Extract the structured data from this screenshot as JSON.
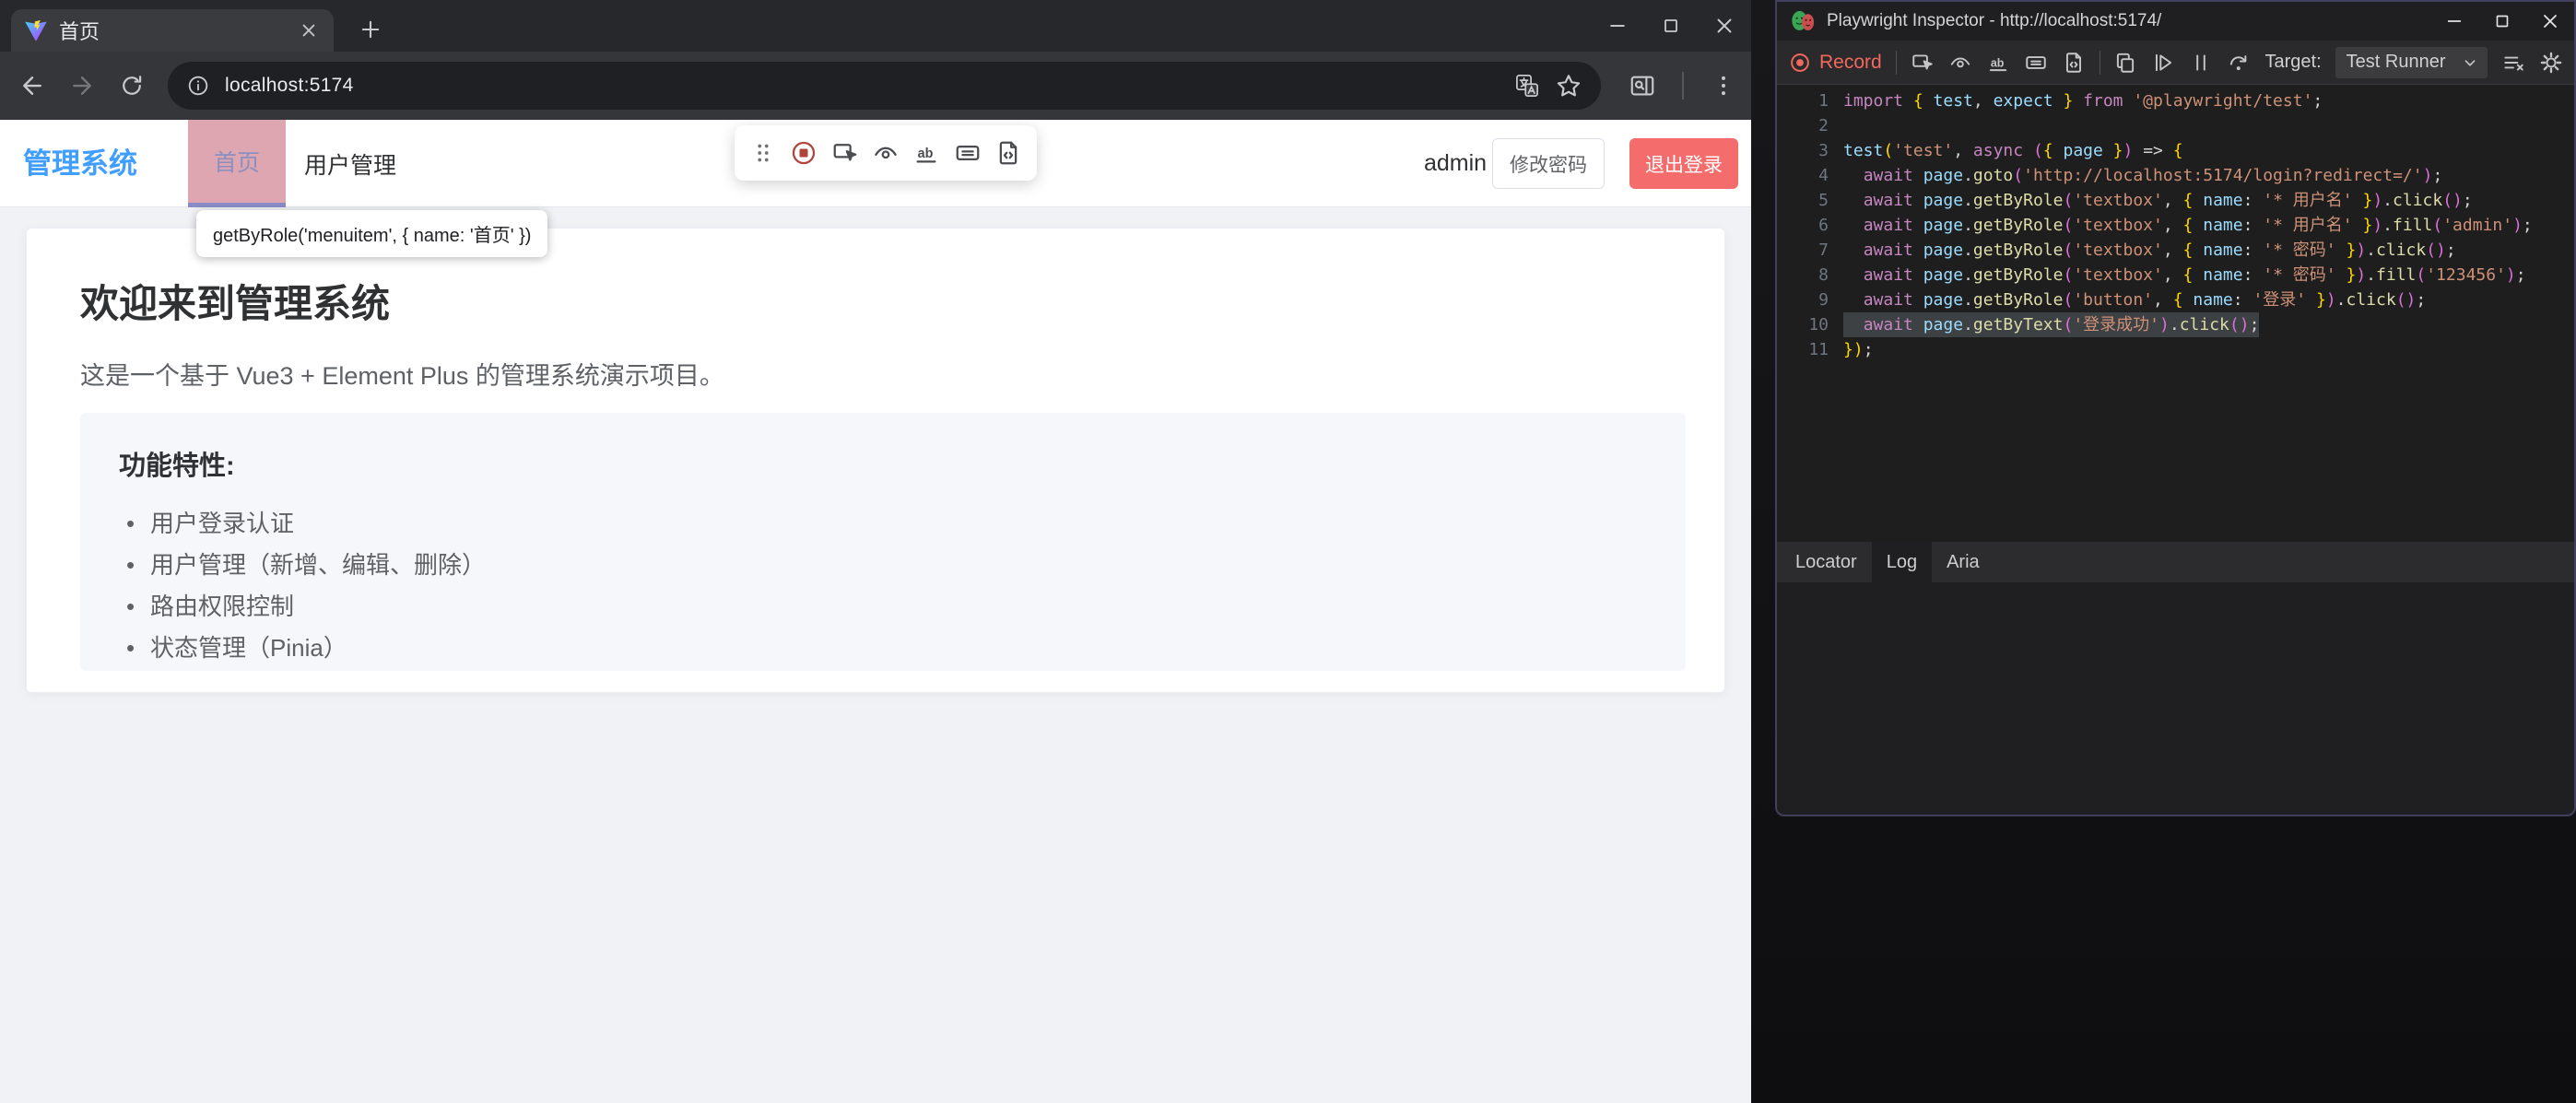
{
  "colors": {
    "brand_blue": "#409eff",
    "danger_red": "#f56c6c",
    "record_red": "#f2685c",
    "pick_highlight_pink": "#dda6b0"
  },
  "browser": {
    "tab_title": "首页",
    "url": "localhost:5174",
    "toolbar_icons": [
      "back",
      "forward",
      "reload"
    ],
    "url_icons": [
      "info",
      "translate",
      "star"
    ],
    "right_icons": [
      "side-panel-search",
      "kebab-menu"
    ]
  },
  "page": {
    "logo": "管理系统",
    "menu": [
      {
        "label": "首页",
        "active": true
      },
      {
        "label": "用户管理",
        "active": false
      }
    ],
    "user": "admin",
    "buttons": {
      "change_password": "修改密码",
      "logout": "退出登录"
    },
    "tooltip": "getByRole('menuitem', { name: '首页' })",
    "float_toolbar": [
      "drag-handle",
      "record",
      "pick-locator",
      "assert-visibility",
      "assert-text",
      "assert-value",
      "assert-snapshot"
    ],
    "heading": "欢迎来到管理系统",
    "description": "这是一个基于 Vue3 + Element Plus 的管理系统演示项目。",
    "features_title": "功能特性:",
    "features": [
      "用户登录认证",
      "用户管理（新增、编辑、删除）",
      "路由权限控制",
      "状态管理（Pinia）"
    ]
  },
  "inspector": {
    "title": "Playwright Inspector - http://localhost:5174/",
    "record_label": "Record",
    "toolbar_group1": [
      "pick-locator",
      "assert-visibility",
      "assert-text",
      "assert-value",
      "assert-snapshot"
    ],
    "toolbar_group2": [
      "copy",
      "resume",
      "pause",
      "step-over"
    ],
    "target_label": "Target:",
    "target_value": "Test Runner",
    "right_icons": [
      "clear-log",
      "gear"
    ],
    "tabs": [
      {
        "label": "Locator",
        "active": false
      },
      {
        "label": "Log",
        "active": true
      },
      {
        "label": "Aria",
        "active": false
      }
    ],
    "code": {
      "highlighted_line": 10,
      "lines": [
        {
          "n": 1,
          "tokens": [
            [
              "kw",
              "import "
            ],
            [
              "b1",
              "{ "
            ],
            [
              "var",
              "test"
            ],
            [
              "pun",
              ", "
            ],
            [
              "var",
              "expect"
            ],
            [
              "b1",
              " }"
            ],
            [
              "kw",
              " from "
            ],
            [
              "str",
              "'@playwright/test'"
            ],
            [
              "pun",
              ";"
            ]
          ]
        },
        {
          "n": 2,
          "tokens": []
        },
        {
          "n": 3,
          "tokens": [
            [
              "var",
              "test"
            ],
            [
              "b1",
              "("
            ],
            [
              "str",
              "'test'"
            ],
            [
              "pun",
              ", "
            ],
            [
              "kw",
              "async "
            ],
            [
              "b2",
              "("
            ],
            [
              "b1",
              "{ "
            ],
            [
              "var",
              "page"
            ],
            [
              "b1",
              " }"
            ],
            [
              "b2",
              ")"
            ],
            [
              "pun",
              " => "
            ],
            [
              "b1",
              "{"
            ]
          ]
        },
        {
          "n": 4,
          "tokens": [
            [
              "pun",
              "  "
            ],
            [
              "kw",
              "await "
            ],
            [
              "var",
              "page"
            ],
            [
              "pun",
              "."
            ],
            [
              "fn",
              "goto"
            ],
            [
              "b2",
              "("
            ],
            [
              "str",
              "'http://localhost:5174/login?redirect=/'"
            ],
            [
              "b2",
              ")"
            ],
            [
              "pun",
              ";"
            ]
          ]
        },
        {
          "n": 5,
          "tokens": [
            [
              "pun",
              "  "
            ],
            [
              "kw",
              "await "
            ],
            [
              "var",
              "page"
            ],
            [
              "pun",
              "."
            ],
            [
              "fn",
              "getByRole"
            ],
            [
              "b2",
              "("
            ],
            [
              "str",
              "'textbox'"
            ],
            [
              "pun",
              ", "
            ],
            [
              "b1",
              "{ "
            ],
            [
              "var",
              "name"
            ],
            [
              "pun",
              ": "
            ],
            [
              "str",
              "'* 用户名'"
            ],
            [
              "b1",
              " }"
            ],
            [
              "b2",
              ")"
            ],
            [
              "pun",
              "."
            ],
            [
              "fn",
              "click"
            ],
            [
              "b2",
              "()"
            ],
            [
              "pun",
              ";"
            ]
          ]
        },
        {
          "n": 6,
          "tokens": [
            [
              "pun",
              "  "
            ],
            [
              "kw",
              "await "
            ],
            [
              "var",
              "page"
            ],
            [
              "pun",
              "."
            ],
            [
              "fn",
              "getByRole"
            ],
            [
              "b2",
              "("
            ],
            [
              "str",
              "'textbox'"
            ],
            [
              "pun",
              ", "
            ],
            [
              "b1",
              "{ "
            ],
            [
              "var",
              "name"
            ],
            [
              "pun",
              ": "
            ],
            [
              "str",
              "'* 用户名'"
            ],
            [
              "b1",
              " }"
            ],
            [
              "b2",
              ")"
            ],
            [
              "pun",
              "."
            ],
            [
              "fn",
              "fill"
            ],
            [
              "b2",
              "("
            ],
            [
              "str",
              "'admin'"
            ],
            [
              "b2",
              ")"
            ],
            [
              "pun",
              ";"
            ]
          ]
        },
        {
          "n": 7,
          "tokens": [
            [
              "pun",
              "  "
            ],
            [
              "kw",
              "await "
            ],
            [
              "var",
              "page"
            ],
            [
              "pun",
              "."
            ],
            [
              "fn",
              "getByRole"
            ],
            [
              "b2",
              "("
            ],
            [
              "str",
              "'textbox'"
            ],
            [
              "pun",
              ", "
            ],
            [
              "b1",
              "{ "
            ],
            [
              "var",
              "name"
            ],
            [
              "pun",
              ": "
            ],
            [
              "str",
              "'* 密码'"
            ],
            [
              "b1",
              " }"
            ],
            [
              "b2",
              ")"
            ],
            [
              "pun",
              "."
            ],
            [
              "fn",
              "click"
            ],
            [
              "b2",
              "()"
            ],
            [
              "pun",
              ";"
            ]
          ]
        },
        {
          "n": 8,
          "tokens": [
            [
              "pun",
              "  "
            ],
            [
              "kw",
              "await "
            ],
            [
              "var",
              "page"
            ],
            [
              "pun",
              "."
            ],
            [
              "fn",
              "getByRole"
            ],
            [
              "b2",
              "("
            ],
            [
              "str",
              "'textbox'"
            ],
            [
              "pun",
              ", "
            ],
            [
              "b1",
              "{ "
            ],
            [
              "var",
              "name"
            ],
            [
              "pun",
              ": "
            ],
            [
              "str",
              "'* 密码'"
            ],
            [
              "b1",
              " }"
            ],
            [
              "b2",
              ")"
            ],
            [
              "pun",
              "."
            ],
            [
              "fn",
              "fill"
            ],
            [
              "b2",
              "("
            ],
            [
              "str",
              "'123456'"
            ],
            [
              "b2",
              ")"
            ],
            [
              "pun",
              ";"
            ]
          ]
        },
        {
          "n": 9,
          "tokens": [
            [
              "pun",
              "  "
            ],
            [
              "kw",
              "await "
            ],
            [
              "var",
              "page"
            ],
            [
              "pun",
              "."
            ],
            [
              "fn",
              "getByRole"
            ],
            [
              "b2",
              "("
            ],
            [
              "str",
              "'button'"
            ],
            [
              "pun",
              ", "
            ],
            [
              "b1",
              "{ "
            ],
            [
              "var",
              "name"
            ],
            [
              "pun",
              ": "
            ],
            [
              "str",
              "'登录'"
            ],
            [
              "b1",
              " }"
            ],
            [
              "b2",
              ")"
            ],
            [
              "pun",
              "."
            ],
            [
              "fn",
              "click"
            ],
            [
              "b2",
              "()"
            ],
            [
              "pun",
              ";"
            ]
          ]
        },
        {
          "n": 10,
          "tokens": [
            [
              "pun",
              "  "
            ],
            [
              "kw",
              "await "
            ],
            [
              "var",
              "page"
            ],
            [
              "pun",
              "."
            ],
            [
              "fn",
              "getByText"
            ],
            [
              "b2",
              "("
            ],
            [
              "str",
              "'登录成功'"
            ],
            [
              "b2",
              ")"
            ],
            [
              "pun",
              "."
            ],
            [
              "fn",
              "click"
            ],
            [
              "b2",
              "()"
            ],
            [
              "pun",
              ";"
            ]
          ]
        },
        {
          "n": 11,
          "tokens": [
            [
              "b1",
              "})"
            ],
            [
              "pun",
              ";"
            ]
          ]
        }
      ]
    }
  }
}
